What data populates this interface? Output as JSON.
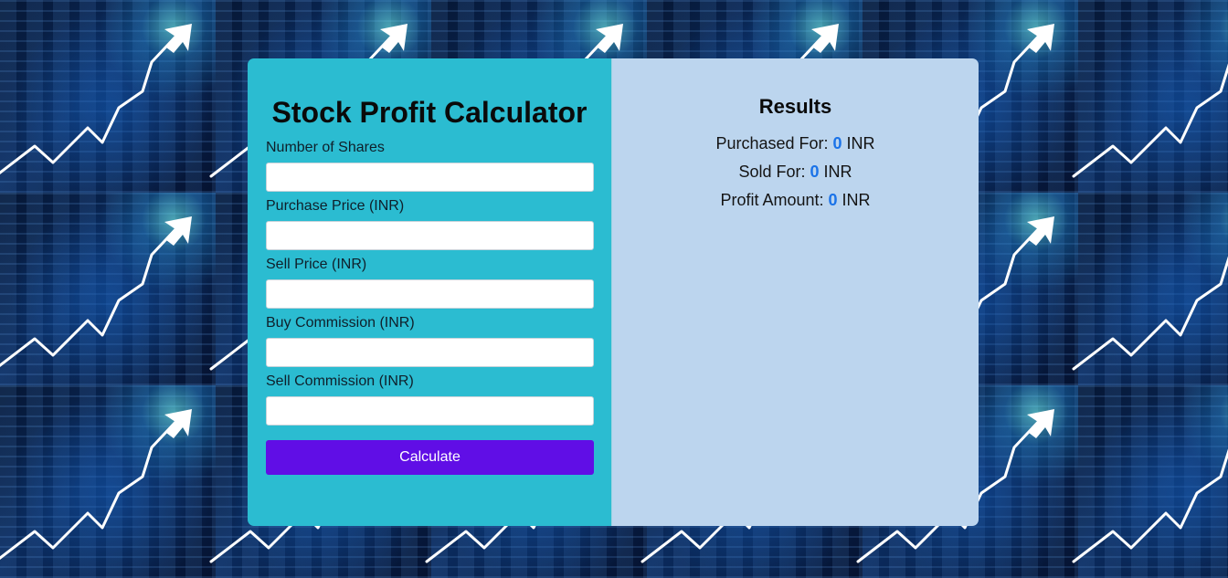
{
  "calculator": {
    "title": "Stock Profit Calculator",
    "fields": [
      {
        "label": "Number of Shares",
        "value": ""
      },
      {
        "label": "Purchase Price (INR)",
        "value": ""
      },
      {
        "label": "Sell Price (INR)",
        "value": ""
      },
      {
        "label": "Buy Commission (INR)",
        "value": ""
      },
      {
        "label": "Sell Commission (INR)",
        "value": ""
      }
    ],
    "button_label": "Calculate"
  },
  "results": {
    "title": "Results",
    "purchased": {
      "label": "Purchased For: ",
      "value": "0",
      "unit": " INR"
    },
    "sold": {
      "label": "Sold For: ",
      "value": "0",
      "unit": " INR"
    },
    "profit": {
      "label": "Profit Amount: ",
      "value": "0",
      "unit": " INR"
    }
  },
  "colors": {
    "left_panel": "#2bbcd1",
    "right_panel": "#bcd5ee",
    "button": "#600ee6",
    "result_value": "#1b73e8"
  }
}
